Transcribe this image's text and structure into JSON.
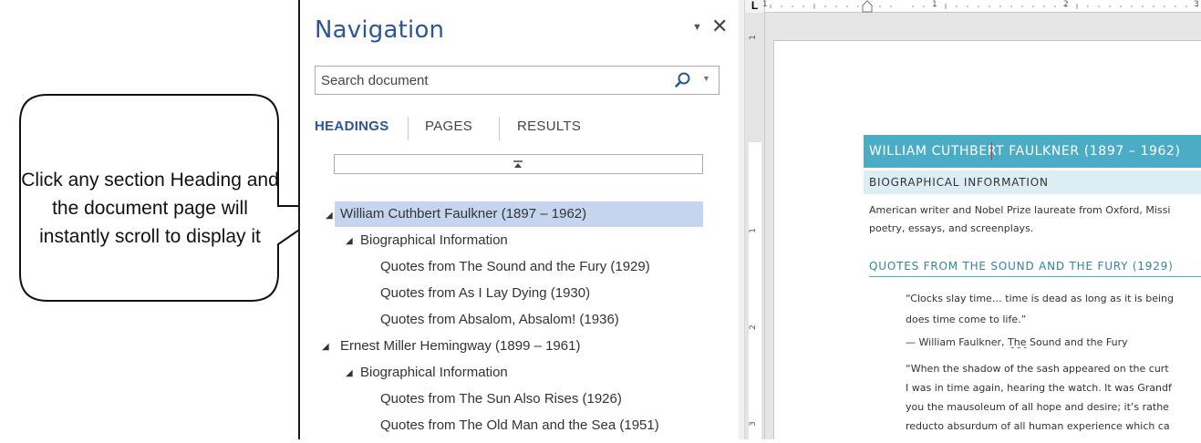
{
  "callout": {
    "text": "Click any section Heading and the document page will instantly scroll to display it"
  },
  "navigation": {
    "title": "Navigation",
    "options_icon": "dropdown-triangle",
    "close_icon": "close-x",
    "search": {
      "placeholder": "Search document",
      "value": ""
    },
    "tabs": [
      {
        "label": "HEADINGS",
        "active": true
      },
      {
        "label": "PAGES",
        "active": false
      },
      {
        "label": "RESULTS",
        "active": false
      }
    ],
    "headings": [
      {
        "label": "William Cuthbert Faulkner (1897 – 1962)",
        "level": 1,
        "selected": true
      },
      {
        "label": "Biographical Information",
        "level": 2,
        "selected": false
      },
      {
        "label": "Quotes from The Sound and the Fury (1929)",
        "level": 3,
        "selected": false
      },
      {
        "label": "Quotes from As I Lay Dying (1930)",
        "level": 3,
        "selected": false
      },
      {
        "label": "Quotes from Absalom, Absalom! (1936)",
        "level": 3,
        "selected": false
      },
      {
        "label": "Ernest Miller Hemingway (1899 – 1961)",
        "level": 1,
        "selected": false
      },
      {
        "label": "Biographical Information",
        "level": 2,
        "selected": false
      },
      {
        "label": "Quotes from The Sun Also Rises (1926)",
        "level": 3,
        "selected": false
      },
      {
        "label": "Quotes from The Old Man and the Sea (1951)",
        "level": 3,
        "selected": false
      }
    ]
  },
  "ruler": {
    "tab_selector": "L",
    "h_numbers": [
      "1",
      "1",
      "2",
      "3"
    ],
    "v_numbers": [
      "1",
      "1",
      "2",
      "3"
    ]
  },
  "document": {
    "heading1": "WILLIAM CUTHBERT FAULKNER (1897 – 1962)",
    "heading2": "BIOGRAPHICAL INFORMATION",
    "para1_line1": "American writer and Nobel Prize laureate from Oxford, Missi",
    "para1_line2": "poetry, essays, and screenplays.",
    "heading3": "QUOTES FROM THE SOUND AND THE FURY (1929)",
    "quote1_line1": "“Clocks slay time… time is dead as long as it is being",
    "quote1_line2": "does time come to life.”",
    "attrib_prefix": "— William Faulkner, ",
    "attrib_squiggle": "The",
    "attrib_suffix": " Sound and the Fury",
    "quote2_line1": "“When the shadow of the sash appeared on the curt",
    "quote2_line2": "I was in time again, hearing the watch. It was Grandf",
    "quote2_line3": "you the mausoleum of all hope and desire; it’s rathe",
    "quote2_line4": "reducto absurdum of all human experience which ca"
  },
  "colors": {
    "accent_blue": "#2b579a",
    "selection": "#c5d5ef",
    "heading1_bg": "#4bacc6",
    "heading2_bg": "#dbeef3",
    "heading3_text": "#31859b"
  }
}
